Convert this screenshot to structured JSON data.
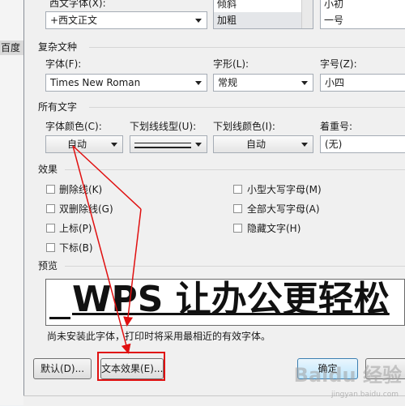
{
  "background": {
    "left_text": "百度"
  },
  "western_font": {
    "label": "西文字体(X):",
    "value": "+西文正文"
  },
  "style_list": {
    "items": [
      "倾斜",
      "加粗"
    ],
    "selected_index": 1
  },
  "size_list": {
    "items": [
      "小初",
      "一号"
    ]
  },
  "complex_script": {
    "group_label": "复杂文种",
    "font_label": "字体(F):",
    "font_value": "Times New Roman",
    "style_label": "字形(L):",
    "style_value": "常规",
    "size_label": "字号(Z):",
    "size_value": "小四"
  },
  "all_text": {
    "group_label": "所有文字",
    "font_color_label": "字体颜色(C):",
    "font_color_value": "自动",
    "underline_type_label": "下划线线型(U):",
    "underline_color_label": "下划线颜色(I):",
    "underline_color_value": "自动",
    "emphasis_label": "着重号:",
    "emphasis_value": "(无)"
  },
  "effects": {
    "group_label": "效果",
    "left": [
      {
        "label": "删除线(K)",
        "checked": false
      },
      {
        "label": "双删除线(G)",
        "checked": false
      },
      {
        "label": "上标(P)",
        "checked": false
      },
      {
        "label": "下标(B)",
        "checked": false
      }
    ],
    "right": [
      {
        "label": "小型大写字母(M)",
        "checked": false
      },
      {
        "label": "全部大写字母(A)",
        "checked": false
      },
      {
        "label": "隐藏文字(H)",
        "checked": false
      }
    ]
  },
  "preview": {
    "group_label": "预览",
    "sample_text": "WPS 让办公更轻松",
    "note": "尚未安装此字体，打印时将采用最相近的有效字体。"
  },
  "buttons": {
    "default_label": "默认(D)...",
    "text_effect_label": "文本效果(E)...",
    "ok_label": "确定",
    "cancel_label": ""
  },
  "annotation": {
    "highlight_color": "#e01010",
    "arrow_color": "#e01010"
  },
  "watermark": {
    "text": "Baidu 经验",
    "sub": "jingyan.baidu.com"
  }
}
